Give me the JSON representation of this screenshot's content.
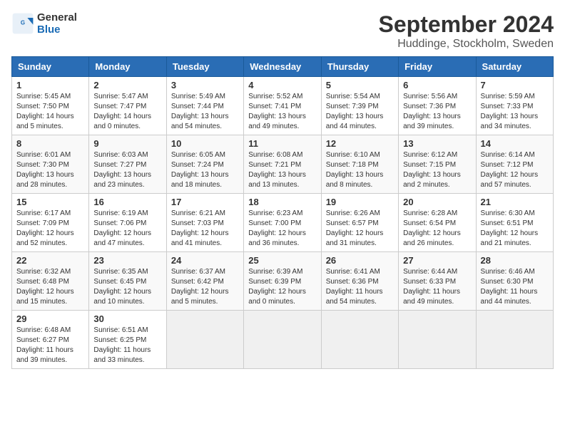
{
  "header": {
    "logo_line1": "General",
    "logo_line2": "Blue",
    "title": "September 2024",
    "subtitle": "Huddinge, Stockholm, Sweden"
  },
  "days_of_week": [
    "Sunday",
    "Monday",
    "Tuesday",
    "Wednesday",
    "Thursday",
    "Friday",
    "Saturday"
  ],
  "weeks": [
    [
      {
        "day": 1,
        "sunrise": "5:45 AM",
        "sunset": "7:50 PM",
        "daylight": "14 hours and 5 minutes."
      },
      {
        "day": 2,
        "sunrise": "5:47 AM",
        "sunset": "7:47 PM",
        "daylight": "14 hours and 0 minutes."
      },
      {
        "day": 3,
        "sunrise": "5:49 AM",
        "sunset": "7:44 PM",
        "daylight": "13 hours and 54 minutes."
      },
      {
        "day": 4,
        "sunrise": "5:52 AM",
        "sunset": "7:41 PM",
        "daylight": "13 hours and 49 minutes."
      },
      {
        "day": 5,
        "sunrise": "5:54 AM",
        "sunset": "7:39 PM",
        "daylight": "13 hours and 44 minutes."
      },
      {
        "day": 6,
        "sunrise": "5:56 AM",
        "sunset": "7:36 PM",
        "daylight": "13 hours and 39 minutes."
      },
      {
        "day": 7,
        "sunrise": "5:59 AM",
        "sunset": "7:33 PM",
        "daylight": "13 hours and 34 minutes."
      }
    ],
    [
      {
        "day": 8,
        "sunrise": "6:01 AM",
        "sunset": "7:30 PM",
        "daylight": "13 hours and 28 minutes."
      },
      {
        "day": 9,
        "sunrise": "6:03 AM",
        "sunset": "7:27 PM",
        "daylight": "13 hours and 23 minutes."
      },
      {
        "day": 10,
        "sunrise": "6:05 AM",
        "sunset": "7:24 PM",
        "daylight": "13 hours and 18 minutes."
      },
      {
        "day": 11,
        "sunrise": "6:08 AM",
        "sunset": "7:21 PM",
        "daylight": "13 hours and 13 minutes."
      },
      {
        "day": 12,
        "sunrise": "6:10 AM",
        "sunset": "7:18 PM",
        "daylight": "13 hours and 8 minutes."
      },
      {
        "day": 13,
        "sunrise": "6:12 AM",
        "sunset": "7:15 PM",
        "daylight": "13 hours and 2 minutes."
      },
      {
        "day": 14,
        "sunrise": "6:14 AM",
        "sunset": "7:12 PM",
        "daylight": "12 hours and 57 minutes."
      }
    ],
    [
      {
        "day": 15,
        "sunrise": "6:17 AM",
        "sunset": "7:09 PM",
        "daylight": "12 hours and 52 minutes."
      },
      {
        "day": 16,
        "sunrise": "6:19 AM",
        "sunset": "7:06 PM",
        "daylight": "12 hours and 47 minutes."
      },
      {
        "day": 17,
        "sunrise": "6:21 AM",
        "sunset": "7:03 PM",
        "daylight": "12 hours and 41 minutes."
      },
      {
        "day": 18,
        "sunrise": "6:23 AM",
        "sunset": "7:00 PM",
        "daylight": "12 hours and 36 minutes."
      },
      {
        "day": 19,
        "sunrise": "6:26 AM",
        "sunset": "6:57 PM",
        "daylight": "12 hours and 31 minutes."
      },
      {
        "day": 20,
        "sunrise": "6:28 AM",
        "sunset": "6:54 PM",
        "daylight": "12 hours and 26 minutes."
      },
      {
        "day": 21,
        "sunrise": "6:30 AM",
        "sunset": "6:51 PM",
        "daylight": "12 hours and 21 minutes."
      }
    ],
    [
      {
        "day": 22,
        "sunrise": "6:32 AM",
        "sunset": "6:48 PM",
        "daylight": "12 hours and 15 minutes."
      },
      {
        "day": 23,
        "sunrise": "6:35 AM",
        "sunset": "6:45 PM",
        "daylight": "12 hours and 10 minutes."
      },
      {
        "day": 24,
        "sunrise": "6:37 AM",
        "sunset": "6:42 PM",
        "daylight": "12 hours and 5 minutes."
      },
      {
        "day": 25,
        "sunrise": "6:39 AM",
        "sunset": "6:39 PM",
        "daylight": "12 hours and 0 minutes."
      },
      {
        "day": 26,
        "sunrise": "6:41 AM",
        "sunset": "6:36 PM",
        "daylight": "11 hours and 54 minutes."
      },
      {
        "day": 27,
        "sunrise": "6:44 AM",
        "sunset": "6:33 PM",
        "daylight": "11 hours and 49 minutes."
      },
      {
        "day": 28,
        "sunrise": "6:46 AM",
        "sunset": "6:30 PM",
        "daylight": "11 hours and 44 minutes."
      }
    ],
    [
      {
        "day": 29,
        "sunrise": "6:48 AM",
        "sunset": "6:27 PM",
        "daylight": "11 hours and 39 minutes."
      },
      {
        "day": 30,
        "sunrise": "6:51 AM",
        "sunset": "6:25 PM",
        "daylight": "11 hours and 33 minutes."
      },
      null,
      null,
      null,
      null,
      null
    ]
  ]
}
